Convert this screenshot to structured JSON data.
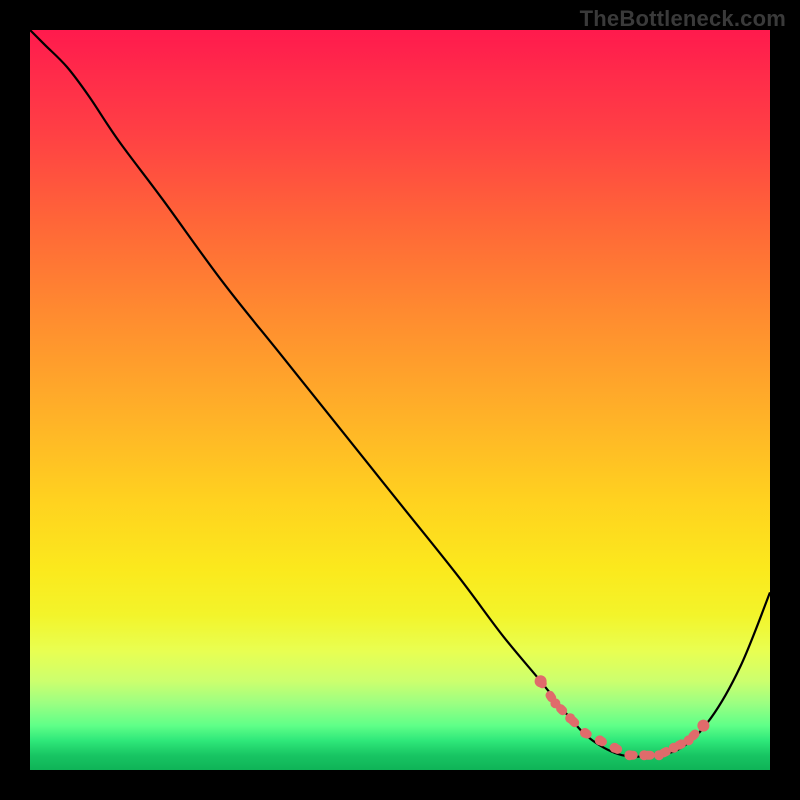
{
  "watermark": "TheBottleneck.com",
  "chart_data": {
    "type": "line",
    "title": "",
    "xlabel": "",
    "ylabel": "",
    "xlim": [
      0,
      100
    ],
    "ylim": [
      0,
      100
    ],
    "grid": false,
    "legend": false,
    "series": [
      {
        "name": "bottleneck-curve",
        "color": "#000000",
        "x": [
          0,
          2,
          5,
          8,
          12,
          18,
          26,
          34,
          42,
          50,
          58,
          64,
          69,
          73,
          76,
          80,
          84,
          88,
          92,
          96,
          100
        ],
        "y": [
          100,
          98,
          95,
          91,
          85,
          77,
          66,
          56,
          46,
          36,
          26,
          18,
          12,
          7,
          4,
          2,
          2,
          3,
          7,
          14,
          24
        ]
      }
    ],
    "markers": {
      "name": "highlight-segment",
      "color": "#e06b6b",
      "points": [
        {
          "x": 69,
          "y": 12
        },
        {
          "x": 71,
          "y": 9
        },
        {
          "x": 73,
          "y": 7
        },
        {
          "x": 75,
          "y": 5
        },
        {
          "x": 77,
          "y": 4
        },
        {
          "x": 79,
          "y": 3
        },
        {
          "x": 81,
          "y": 2
        },
        {
          "x": 83,
          "y": 2
        },
        {
          "x": 85,
          "y": 2
        },
        {
          "x": 87,
          "y": 3
        },
        {
          "x": 89,
          "y": 4
        },
        {
          "x": 91,
          "y": 6
        }
      ]
    },
    "background_gradient": {
      "top": "#ff1a4d",
      "mid": "#ffd31f",
      "bottom": "#0fb357"
    }
  }
}
